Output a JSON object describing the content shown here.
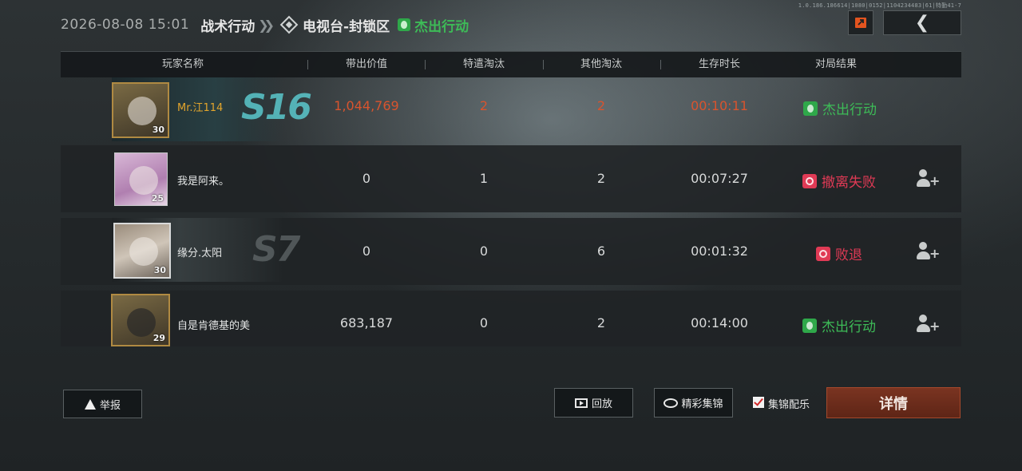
{
  "version_text": "1.0.186.186614|1080|0152|1104234483|61|特勤41-7",
  "header": {
    "datetime": "2026-08-08 15:01",
    "mode": "战术行动",
    "map": "电视台-封锁区",
    "outcome": "杰出行动"
  },
  "columns": [
    "玩家名称",
    "带出价值",
    "特遣淘汰",
    "其他淘汰",
    "生存时长",
    "对局结果"
  ],
  "players": [
    {
      "name": "Mr.江114",
      "level": "30",
      "value": "1,044,769",
      "special_elims": "2",
      "other_elims": "2",
      "survival": "00:10:11",
      "result": "杰出行动",
      "result_type": "success",
      "season_badge": "S16",
      "highlight": true
    },
    {
      "name": "我是阿来。",
      "level": "25",
      "value": "0",
      "special_elims": "1",
      "other_elims": "2",
      "survival": "00:07:27",
      "result": "撤离失败",
      "result_type": "fail",
      "season_badge": "",
      "highlight": false
    },
    {
      "name": "缘分.太阳",
      "level": "30",
      "value": "0",
      "special_elims": "0",
      "other_elims": "6",
      "survival": "00:01:32",
      "result": "败退",
      "result_type": "fail",
      "season_badge": "S7",
      "highlight": false
    },
    {
      "name": "自是肯德基的美",
      "level": "29",
      "value": "683,187",
      "special_elims": "0",
      "other_elims": "2",
      "survival": "00:14:00",
      "result": "杰出行动",
      "result_type": "success",
      "season_badge": "",
      "highlight": false
    }
  ],
  "buttons": {
    "report": "举报",
    "replay": "回放",
    "highlights": "精彩集锦",
    "music_label": "集锦配乐",
    "music_checked": true,
    "details": "详情",
    "back": "❮"
  },
  "colors": {
    "success": "#3dbb57",
    "fail": "#e03a55",
    "highlight_text": "#d8542e",
    "player_gold": "#e3a52c",
    "detail_button": "#6b2d1c"
  }
}
